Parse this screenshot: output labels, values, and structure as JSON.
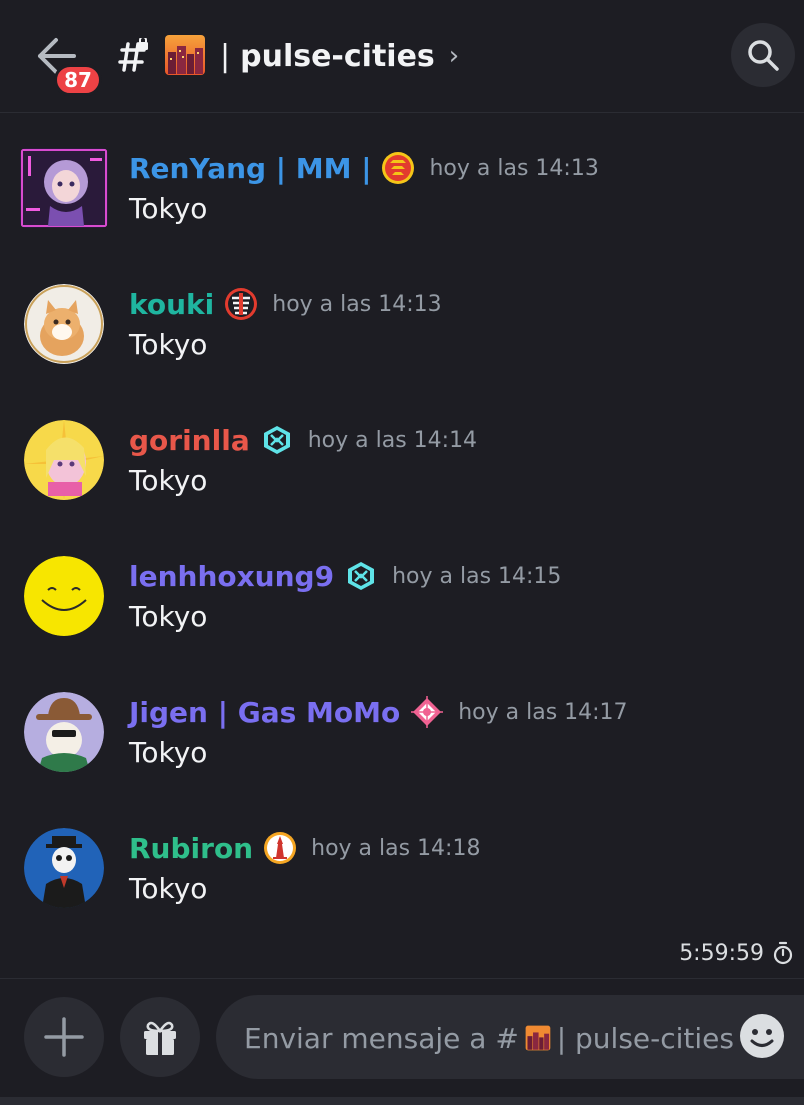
{
  "header": {
    "notification_count": "87",
    "channel_name": "pulse-cities",
    "separator": "|",
    "chevron": "›"
  },
  "messages": [
    {
      "username": "RenYang | MM |",
      "color": "#3c95e6",
      "timestamp": "hoy a las 14:13",
      "text": "Tokyo",
      "icon": "pagoda-badge-icon"
    },
    {
      "username": "kouki",
      "color": "#1fb5a0",
      "timestamp": "hoy a las 14:13",
      "text": "Tokyo",
      "icon": "pagoda-red-badge-icon"
    },
    {
      "username": "gorinlla",
      "color": "#e8574a",
      "timestamp": "hoy a las 14:14",
      "text": "Tokyo",
      "icon": "cyan-crest-icon"
    },
    {
      "username": "lenhhoxung9",
      "color": "#7a6ff0",
      "timestamp": "hoy a las 14:15",
      "text": "Tokyo",
      "icon": "cyan-crest-icon"
    },
    {
      "username": "Jigen | Gas MoMo",
      "color": "#7a6ff0",
      "timestamp": "hoy a las 14:17",
      "text": "Tokyo",
      "icon": "pink-crosshair-icon"
    },
    {
      "username": "Rubiron",
      "color": "#2fbf8b",
      "timestamp": "hoy a las 14:18",
      "text": "Tokyo",
      "icon": "tower-badge-icon"
    }
  ],
  "timer": "5:59:59",
  "composer": {
    "placeholder_prefix": "Enviar mensaje a #",
    "placeholder_suffix": "| pulse-cities"
  }
}
